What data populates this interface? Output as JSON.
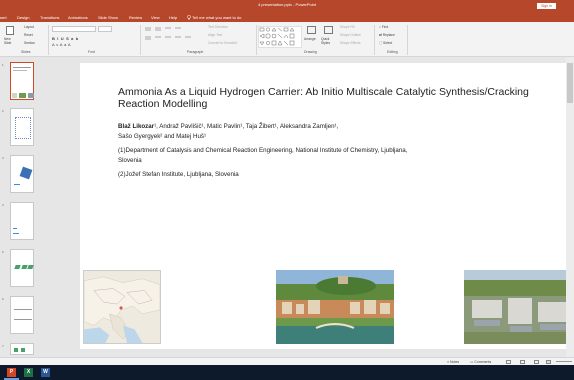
{
  "window": {
    "title": "4 presentation.pptx - PowerPoint",
    "signin_label": "Sign in"
  },
  "ribbon_tabs": [
    "sert",
    "Design",
    "Transitions",
    "Animations",
    "Slide Show",
    "Review",
    "View",
    "Help"
  ],
  "tell_me": "Tell me what you want to do",
  "ribbon": {
    "new_slide": "New Slide",
    "layout": "Layout",
    "reset": "Reset",
    "section": "Section",
    "text_direction": "Text Direction",
    "align_text": "Align Text",
    "convert_smartart": "Convert to SmartArt",
    "arrange": "Arrange",
    "quick_styles": "Quick Styles",
    "shape_fill": "Shape Fill",
    "shape_outline": "Shape Outline",
    "shape_effects": "Shape Effects",
    "find": "Find",
    "replace": "Replace",
    "select": "Select",
    "groups": {
      "slides": "Slides",
      "font": "Font",
      "paragraph": "Paragraph",
      "drawing": "Drawing",
      "editing": "Editing"
    }
  },
  "thumbnails": [
    "1",
    "2",
    "3",
    "4",
    "5",
    "6",
    "7"
  ],
  "slide": {
    "title": "Ammonia As a Liquid Hydrogen Carrier: Ab Initio Multiscale Catalytic Synthesis/Cracking Reaction Modelling",
    "author_lead": "Blaž Likozar",
    "authors_rest_1": "¹, Andraž Pavlišič¹, Matic Pavlin¹, Taja Žibert¹, Aleksandra Zamljen¹,",
    "authors_rest_2": "Sašo Gyergyek² and Matej Huš¹",
    "affiliation_1": "(1)Department of Catalysis and Chemical Reaction Engineering, National Institute of Chemistry, Ljubljana, Slovenia",
    "affiliation_2": "(2)Jožef Stefan Institute, Ljubljana, Slovenia"
  },
  "status": {
    "notes": "Notes",
    "comments": "Comments"
  },
  "taskbar": [
    "P",
    "X",
    "W"
  ],
  "colors": {
    "accent": "#b7472a",
    "taskbar": "#0c1a2b"
  }
}
